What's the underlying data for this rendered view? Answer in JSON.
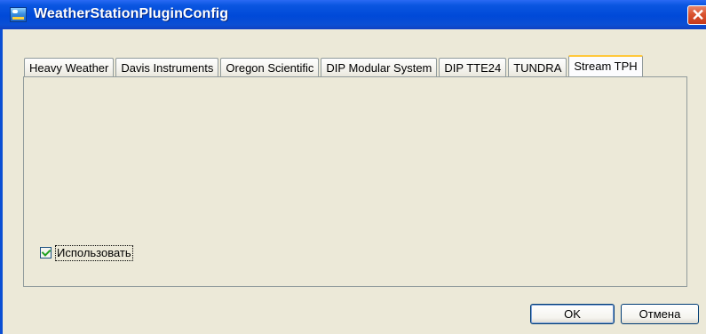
{
  "window": {
    "title": "WeatherStationPluginConfig",
    "close_glyph": "✕"
  },
  "tabs": [
    {
      "label": "Heavy Weather",
      "active": false
    },
    {
      "label": "Davis Instruments",
      "active": false
    },
    {
      "label": "Oregon Scientific",
      "active": false
    },
    {
      "label": "DIP Modular System",
      "active": false
    },
    {
      "label": "DIP TTE24",
      "active": false
    },
    {
      "label": "TUNDRA",
      "active": false
    },
    {
      "label": "Stream TPH",
      "active": true
    }
  ],
  "panel": {
    "use_checkbox_label": "Использовать",
    "use_checked": true
  },
  "buttons": {
    "ok": "OK",
    "cancel": "Отмена"
  },
  "icons": {
    "app": "weather-station-app-icon",
    "close": "close-icon",
    "check": "checkmark-icon"
  },
  "colors": {
    "titlebar": "#0049d8",
    "window_bg": "#ece9d8",
    "active_tab_accent": "#ffc83c",
    "close_button": "#d9532e",
    "checkmark": "#21a121"
  }
}
